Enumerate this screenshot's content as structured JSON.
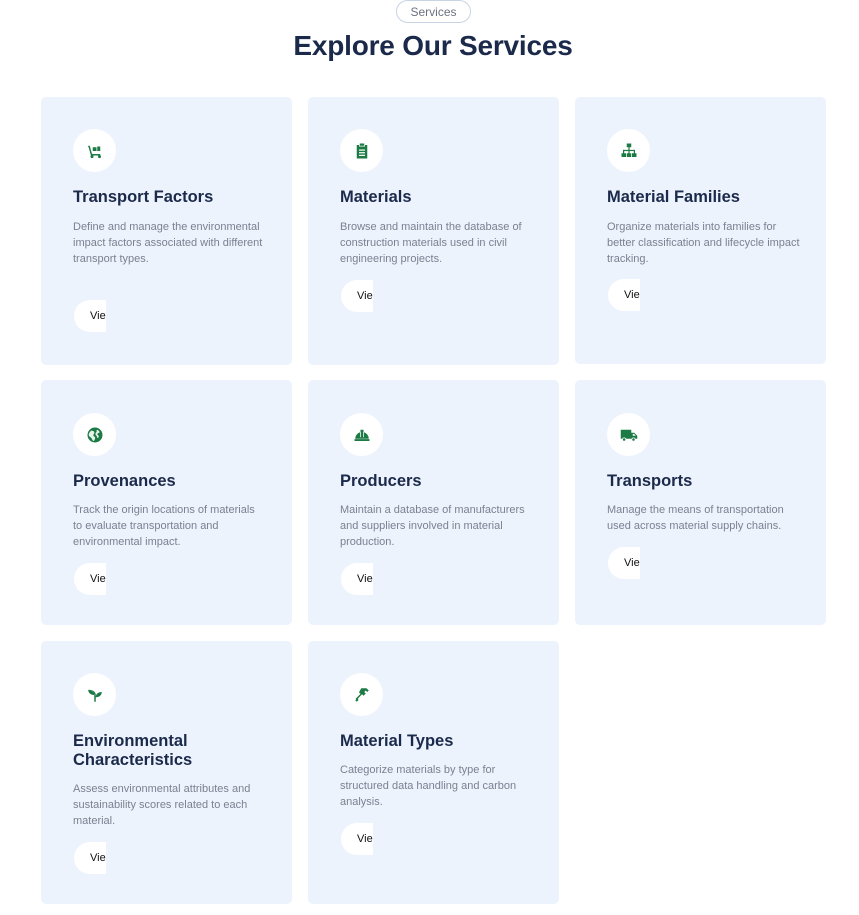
{
  "section": {
    "tag": "Services",
    "title": "Explore Our Services"
  },
  "colors": {
    "accent": "#1c7a45",
    "title": "#1b2a4a",
    "card_bg": "#edf3fd",
    "text_muted": "#7a8190"
  },
  "cards": [
    {
      "icon": "dolly-icon",
      "title": "Transport Factors",
      "description": "Define and manage the environmental impact factors associated with different transport types.",
      "button": "Vie"
    },
    {
      "icon": "clipboard-list-icon",
      "title": "Materials",
      "description": "Browse and maintain the database of construction materials used in civil engineering projects.",
      "button": "Vie"
    },
    {
      "icon": "sitemap-icon",
      "title": "Material Families",
      "description": "Organize materials into families for better classification and lifecycle impact tracking.",
      "button": "Vie"
    },
    {
      "icon": "globe-icon",
      "title": "Provenances",
      "description": "Track the origin locations of materials to evaluate transportation and environmental impact.",
      "button": "Vie"
    },
    {
      "icon": "hard-hat-icon",
      "title": "Producers",
      "description": "Maintain a database of manufacturers and suppliers involved in material production.",
      "button": "Vie"
    },
    {
      "icon": "truck-icon",
      "title": "Transports",
      "description": "Manage the means of transportation used across material supply chains.",
      "button": "Vie"
    },
    {
      "icon": "seedling-icon",
      "title": "Environmental Characteristics",
      "description": "Assess environmental attributes and sustainability scores related to each material.",
      "button": "Vie"
    },
    {
      "icon": "hammer-icon",
      "title": "Material Types",
      "description": "Categorize materials by type for structured data handling and carbon analysis.",
      "button": "Vie"
    }
  ]
}
